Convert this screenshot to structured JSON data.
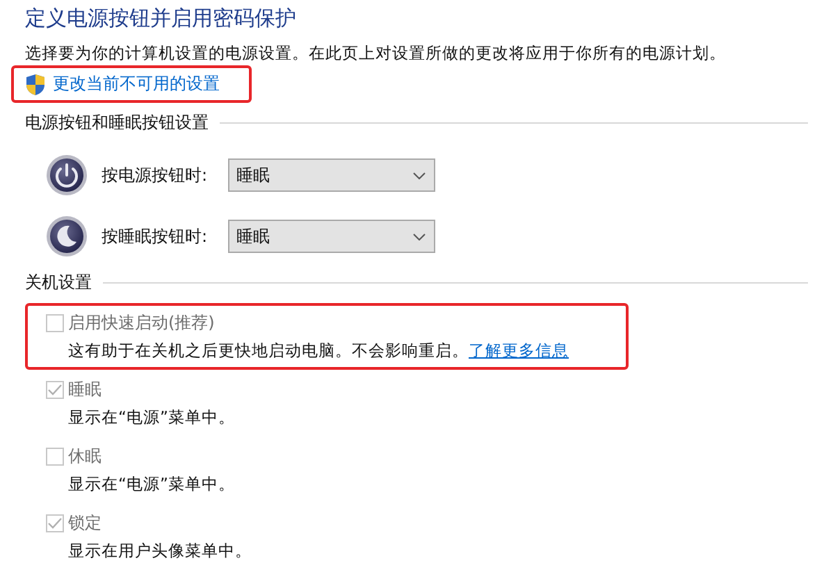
{
  "title": "定义电源按钮并启用密码保护",
  "description": "选择要为你的计算机设置的电源设置。在此页上对设置所做的更改将应用于你所有的电源计划。",
  "admin_link": {
    "label": "更改当前不可用的设置",
    "highlighted": true
  },
  "button_section": {
    "heading": "电源按钮和睡眠按钮设置",
    "rows": [
      {
        "kind": "power",
        "label": "按电源按钮时:",
        "value": "睡眠"
      },
      {
        "kind": "sleep",
        "label": "按睡眠按钮时:",
        "value": "睡眠"
      }
    ]
  },
  "shutdown_section": {
    "heading": "关机设置",
    "options": [
      {
        "label": "启用快速启动(推荐)",
        "checked": false,
        "disabled": true,
        "highlighted": true,
        "description": "这有助于在关机之后更快地启动电脑。不会影响重启。",
        "link": "了解更多信息"
      },
      {
        "label": "睡眠",
        "checked": true,
        "disabled": true,
        "highlighted": false,
        "description": "显示在“电源”菜单中。"
      },
      {
        "label": "休眠",
        "checked": false,
        "disabled": true,
        "highlighted": false,
        "description": "显示在“电源”菜单中。"
      },
      {
        "label": "锁定",
        "checked": true,
        "disabled": true,
        "highlighted": false,
        "description": "显示在用户头像菜单中。"
      }
    ]
  }
}
